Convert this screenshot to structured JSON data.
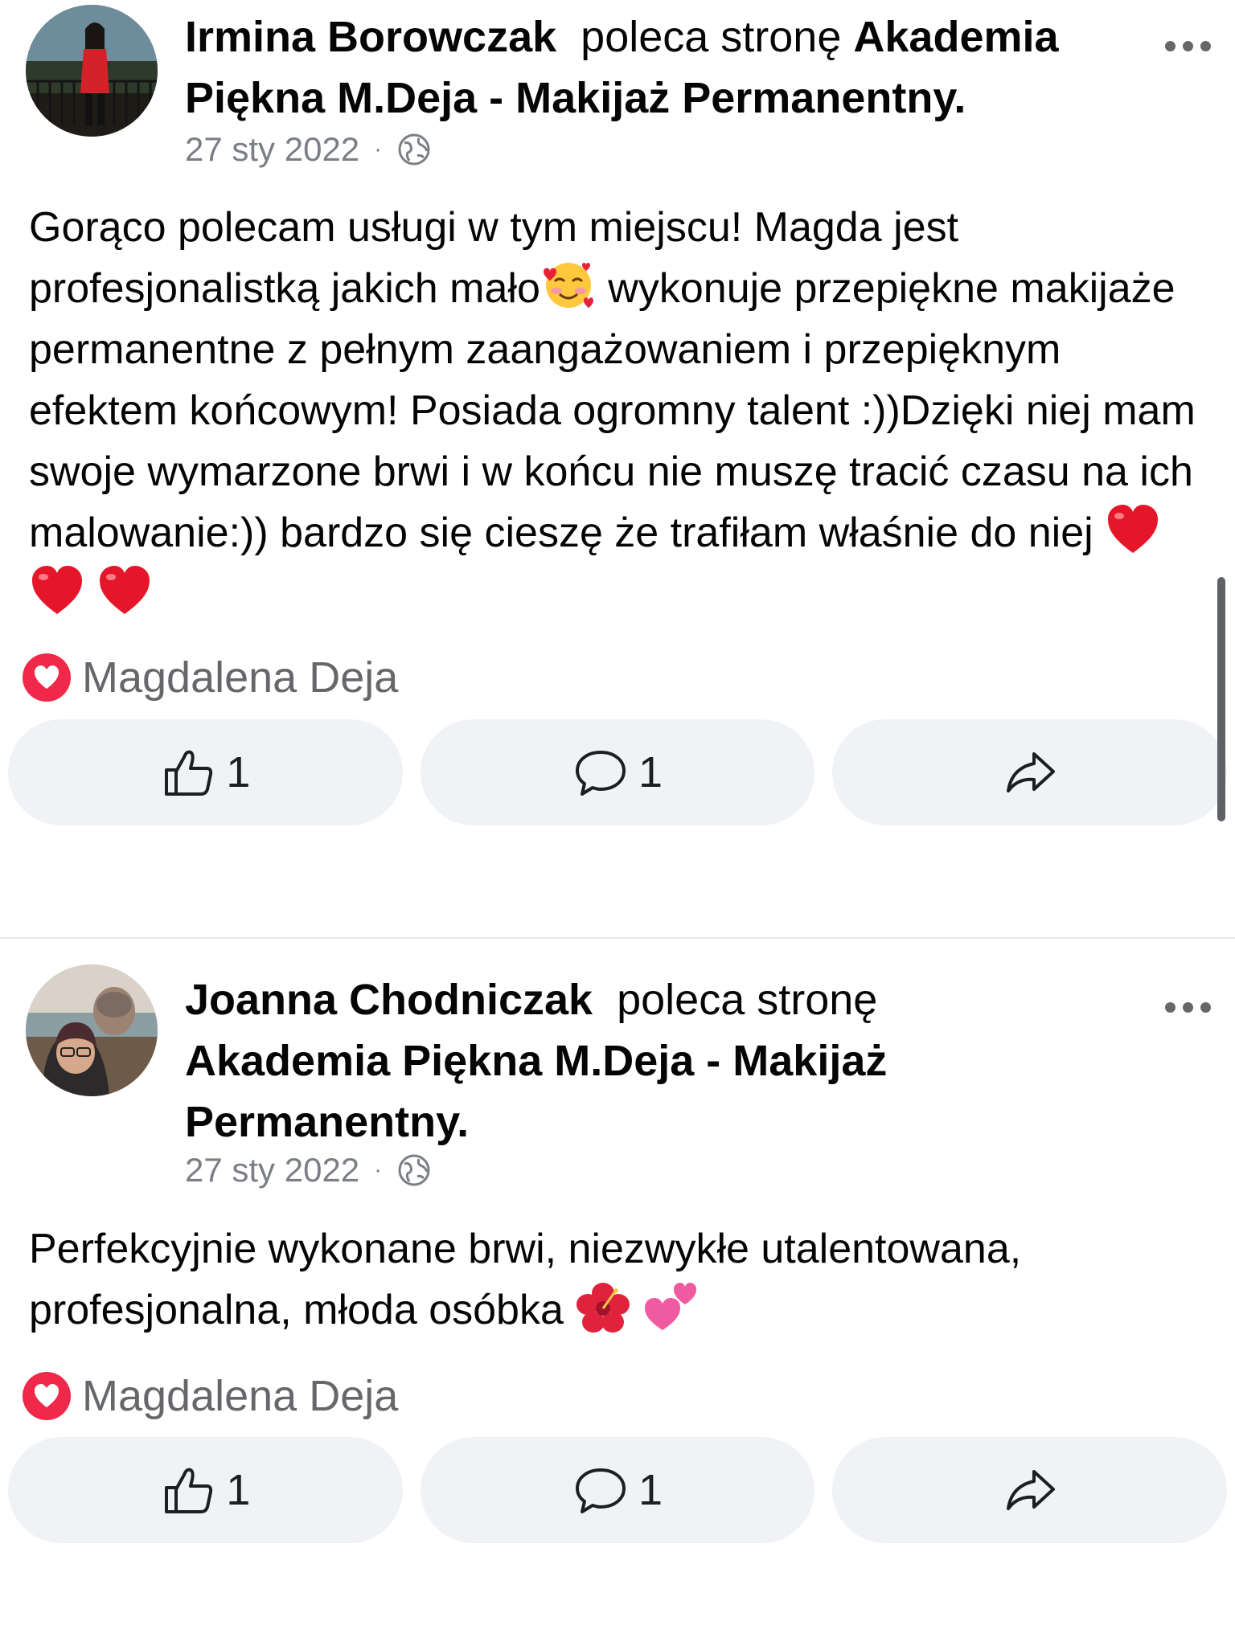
{
  "posts": [
    {
      "author": "Irmina Borowczak",
      "verb": "poleca stronę",
      "page_name": "Akademia Piękna M.Deja  - Makijaż Permanentny.",
      "date": "27 sty 2022",
      "separator": "·",
      "text_parts": [
        "Gorąco polecam usługi w tym miejscu! Magda jest profesjonalistką jakich mało",
        " wykonuje przepiękne makijaże permanentne z pełnym zaangażowaniem i przepięknym efektem końcowym!  Posiada ogromny talent :))Dzięki niej mam swoje wymarzone brwi i w końcu nie muszę tracić czasu na ich malowanie:)) bardzo się cieszę że trafiłam właśnie do niej "
      ],
      "emojis": [
        "smiling-face-with-hearts",
        "red-heart",
        "red-heart",
        "red-heart"
      ],
      "reaction_by": "Magdalena Deja",
      "like_count": "1",
      "comment_count": "1"
    },
    {
      "author": "Joanna Chodniczak",
      "verb": "poleca stronę",
      "page_name": "Akademia Piękna M.Deja  - Makijaż Permanentny.",
      "date": "27 sty 2022",
      "separator": "·",
      "text_parts": [
        "Perfekcyjnie wykonane brwi, niezwykłe utalentowana, profesjonalna, młoda osóbka "
      ],
      "emojis": [
        "hibiscus",
        "two-hearts"
      ],
      "reaction_by": "Magdalena Deja",
      "like_count": "1",
      "comment_count": "1"
    }
  ],
  "icons": {
    "privacy": "globe-icon",
    "like": "thumbs-up-icon",
    "comment": "speech-bubble-icon",
    "share": "share-arrow-icon",
    "more": "more-options-icon",
    "reaction": "heart-reaction-icon"
  },
  "colors": {
    "reaction_heart": "#f0284a",
    "button_bg": "#f0f2f5",
    "meta_text": "#7b7f85"
  }
}
